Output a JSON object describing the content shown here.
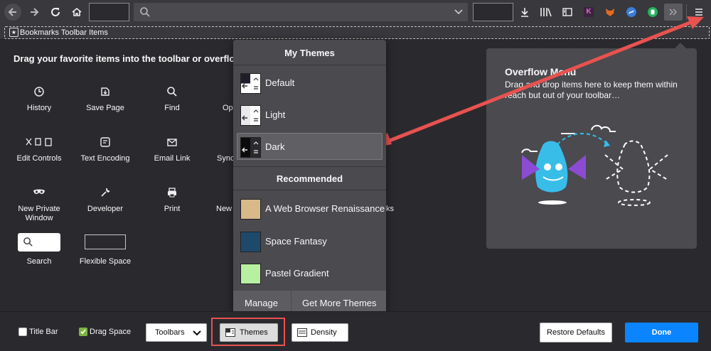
{
  "bookmarks_toolbar": {
    "label": "Bookmarks Toolbar Items"
  },
  "palette": {
    "title": "Drag your favorite items into the toolbar or overflow",
    "items": [
      {
        "label": "History"
      },
      {
        "label": "Save Page"
      },
      {
        "label": "Find"
      },
      {
        "label": "Op"
      },
      {
        "label": "Edit Controls"
      },
      {
        "label": "Text Encoding"
      },
      {
        "label": "Email Link"
      },
      {
        "label": "Sync"
      },
      {
        "label": "New Private Window"
      },
      {
        "label": "Developer"
      },
      {
        "label": "Print"
      },
      {
        "label": "New"
      },
      {
        "label": "Search"
      },
      {
        "label": "Flexible Space"
      }
    ],
    "hidden_fragment": "ks"
  },
  "themes_panel": {
    "my_themes_heading": "My Themes",
    "my_themes": [
      {
        "label": "Default",
        "selected": false
      },
      {
        "label": "Light",
        "selected": false
      },
      {
        "label": "Dark",
        "selected": true
      }
    ],
    "recommended_heading": "Recommended",
    "recommended": [
      {
        "label": "A Web Browser Renaissance",
        "color": "#d8b98a"
      },
      {
        "label": "Space Fantasy",
        "color": "#1d4a6b"
      },
      {
        "label": "Pastel Gradient",
        "color": "#b7f0a0"
      }
    ],
    "manage_label": "Manage",
    "get_more_label": "Get More Themes"
  },
  "overflow_panel": {
    "title": "Overflow Menu",
    "description": "Drag and drop items here to keep them within reach but out of your toolbar…"
  },
  "bottom_bar": {
    "title_bar_label": "Title Bar",
    "title_bar_checked": false,
    "drag_space_label": "Drag Space",
    "drag_space_checked": true,
    "toolbars_label": "Toolbars",
    "themes_label": "Themes",
    "density_label": "Density",
    "restore_label": "Restore Defaults",
    "done_label": "Done"
  },
  "colors": {
    "accent": "#0a84ff",
    "annotation": "#e8524f",
    "panel_bg": "#4a4a4f"
  }
}
